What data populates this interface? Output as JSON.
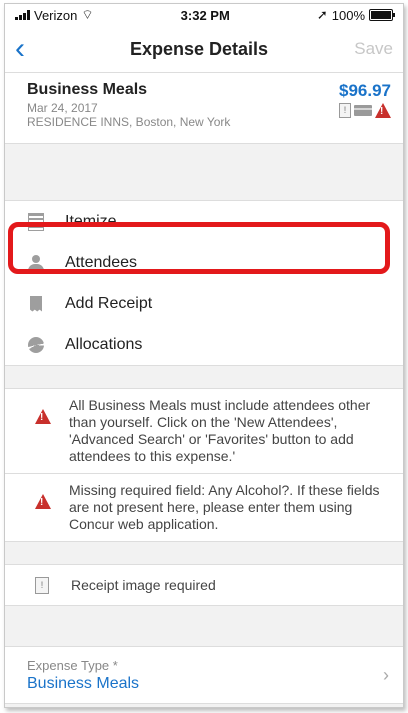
{
  "status_bar": {
    "carrier": "Verizon",
    "time": "3:32 PM",
    "battery": "100%"
  },
  "nav": {
    "back_icon": "chevron-left-icon",
    "title": "Expense Details",
    "save_label": "Save"
  },
  "expense": {
    "name": "Business Meals",
    "date": "Mar 24, 2017",
    "vendor": "RESIDENCE INNS, Boston, New York",
    "amount": "$96.97"
  },
  "menu": {
    "itemize": "Itemize",
    "attendees": "Attendees",
    "add_receipt": "Add Receipt",
    "allocations": "Allocations"
  },
  "alerts": [
    {
      "text": "All Business Meals must include attendees other than yourself.  Click on the 'New Attendees', 'Advanced Search' or 'Favorites' button to add attendees to this expense.'"
    },
    {
      "text": "Missing required field: Any Alcohol?. If these fields are not present here, please enter them using Concur web application."
    }
  ],
  "receipt_notice": "Receipt image required",
  "expense_type": {
    "label": "Expense Type *",
    "value": "Business Meals"
  },
  "colors": {
    "accent": "#1a73c9",
    "warning": "#c8302c",
    "highlight": "#e3191b"
  }
}
